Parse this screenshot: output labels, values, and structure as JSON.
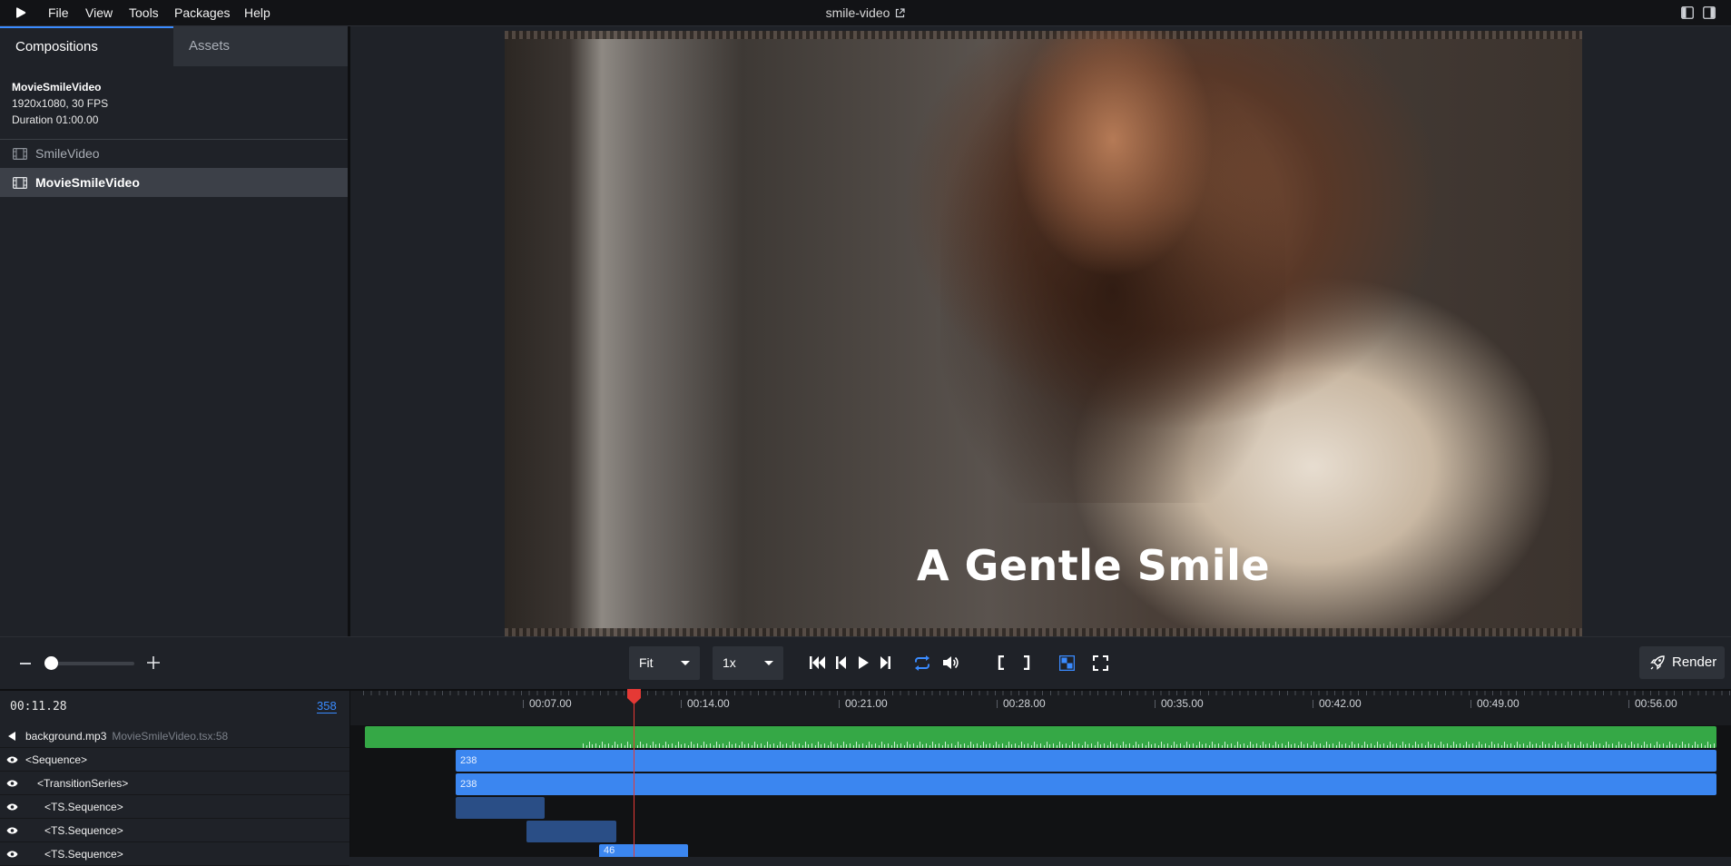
{
  "menubar": {
    "items": [
      "File",
      "View",
      "Tools",
      "Packages",
      "Help"
    ],
    "project_title": "smile-video"
  },
  "sidebar": {
    "tabs": [
      "Compositions",
      "Assets"
    ],
    "active_tab": "Compositions",
    "composition_info": {
      "name": "MovieSmileVideo",
      "resolution": "1920x1080, 30 FPS",
      "duration": "Duration 01:00.00"
    },
    "compositions": [
      {
        "label": "SmileVideo",
        "selected": false
      },
      {
        "label": "MovieSmileVideo",
        "selected": true
      }
    ]
  },
  "preview": {
    "caption": "A Gentle Smile"
  },
  "controls": {
    "zoom_level": 0.0,
    "fit_value": "Fit",
    "speed_value": "1x",
    "render_label": "Render",
    "accent": "#3a8bff"
  },
  "timeline": {
    "timecode": "00:11.28",
    "frame": "358",
    "tick_labels": [
      "00:07.00",
      "00:14.00",
      "00:21.00",
      "00:28.00",
      "00:35.00",
      "00:42.00",
      "00:49.00",
      "00:56.00"
    ],
    "layers": [
      {
        "label": "background.mp3",
        "source": "MovieSmileVideo.tsx:58",
        "icon": "speaker-icon"
      },
      {
        "label": "<Sequence>",
        "icon": "eye-icon"
      },
      {
        "label": "<TransitionSeries>",
        "icon": "eye-icon"
      },
      {
        "label": "<TS.Sequence>",
        "icon": "eye-icon"
      },
      {
        "label": "<TS.Sequence>",
        "icon": "eye-icon"
      },
      {
        "label": "<TS.Sequence>",
        "icon": "eye-icon"
      }
    ],
    "track_labels": [
      "238",
      "238",
      "",
      "",
      "46"
    ],
    "colors": {
      "audio": "#35a846",
      "sequence": "#3b86f0",
      "ts_sequence": "#2a4e86",
      "playhead": "#e53935"
    }
  }
}
